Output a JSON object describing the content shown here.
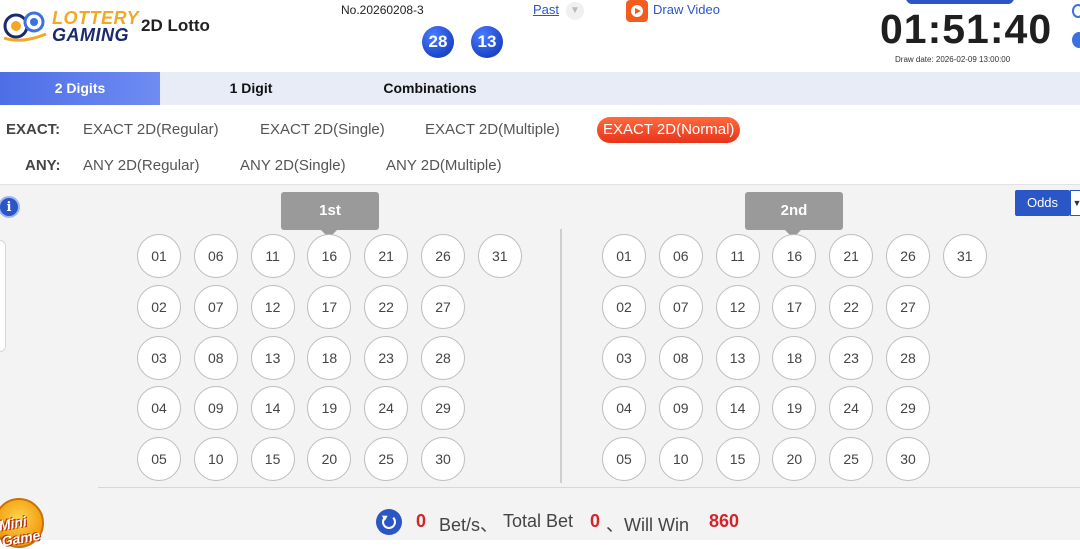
{
  "header": {
    "logo_line1": "LOTTERY",
    "logo_line2": "GAMING",
    "app_title": "2D Lotto",
    "draw_number": "No.20260208-3",
    "results": [
      "28",
      "13"
    ],
    "past_label": "Past",
    "draw_video_label": "Draw Video",
    "countdown": "01:51:40",
    "draw_date": "Draw date: 2026-02-09 13:00:00"
  },
  "tabs": [
    {
      "label": "2 Digits",
      "active": true
    },
    {
      "label": "1 Digit",
      "active": false
    },
    {
      "label": "Combinations",
      "active": false
    }
  ],
  "filters": {
    "exact_label": "EXACT:",
    "exact_options": [
      {
        "label": "EXACT 2D(Regular)",
        "active": false
      },
      {
        "label": "EXACT 2D(Single)",
        "active": false
      },
      {
        "label": "EXACT 2D(Multiple)",
        "active": false
      },
      {
        "label": "EXACT 2D(Normal)",
        "active": true
      }
    ],
    "any_label": "ANY:",
    "any_options": [
      {
        "label": "ANY 2D(Regular)"
      },
      {
        "label": "ANY 2D(Single)"
      },
      {
        "label": "ANY 2D(Multiple)"
      }
    ]
  },
  "board": {
    "info_icon": "i",
    "odds_label": "Odds",
    "positions": [
      {
        "label": "1st",
        "numbers": [
          "01",
          "06",
          "11",
          "16",
          "21",
          "26",
          "31",
          "02",
          "07",
          "12",
          "17",
          "22",
          "27",
          "03",
          "08",
          "13",
          "18",
          "23",
          "28",
          "04",
          "09",
          "14",
          "19",
          "24",
          "29",
          "05",
          "10",
          "15",
          "20",
          "25",
          "30"
        ]
      },
      {
        "label": "2nd",
        "numbers": [
          "01",
          "06",
          "11",
          "16",
          "21",
          "26",
          "31",
          "02",
          "07",
          "12",
          "17",
          "22",
          "27",
          "03",
          "08",
          "13",
          "18",
          "23",
          "28",
          "04",
          "09",
          "14",
          "19",
          "24",
          "29",
          "05",
          "10",
          "15",
          "20",
          "25",
          "30"
        ]
      }
    ]
  },
  "footer": {
    "bets_count": "0",
    "bets_label": "Bet/s、",
    "total_bet_label": "Total Bet",
    "total_bet_value": "0",
    "will_win_label": "、Will Win",
    "will_win_value": "860",
    "mini_game_label": "Mini Game"
  },
  "colors": {
    "accent": "#2a56c6",
    "active_chip": "#e8331c",
    "ball": "#1d45c9",
    "win_value": "#d8222a"
  }
}
